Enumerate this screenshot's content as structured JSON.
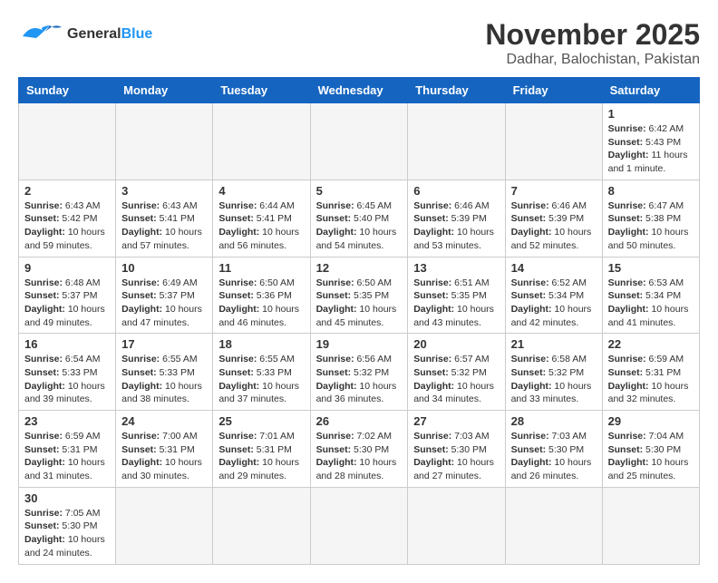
{
  "header": {
    "logo_general": "General",
    "logo_blue": "Blue",
    "month": "November 2025",
    "location": "Dadhar, Balochistan, Pakistan"
  },
  "days_of_week": [
    "Sunday",
    "Monday",
    "Tuesday",
    "Wednesday",
    "Thursday",
    "Friday",
    "Saturday"
  ],
  "weeks": [
    [
      {
        "day": "",
        "info": ""
      },
      {
        "day": "",
        "info": ""
      },
      {
        "day": "",
        "info": ""
      },
      {
        "day": "",
        "info": ""
      },
      {
        "day": "",
        "info": ""
      },
      {
        "day": "",
        "info": ""
      },
      {
        "day": "1",
        "info": "Sunrise: 6:42 AM\nSunset: 5:43 PM\nDaylight: 11 hours and 1 minute."
      }
    ],
    [
      {
        "day": "2",
        "info": "Sunrise: 6:43 AM\nSunset: 5:42 PM\nDaylight: 10 hours and 59 minutes."
      },
      {
        "day": "3",
        "info": "Sunrise: 6:43 AM\nSunset: 5:41 PM\nDaylight: 10 hours and 57 minutes."
      },
      {
        "day": "4",
        "info": "Sunrise: 6:44 AM\nSunset: 5:41 PM\nDaylight: 10 hours and 56 minutes."
      },
      {
        "day": "5",
        "info": "Sunrise: 6:45 AM\nSunset: 5:40 PM\nDaylight: 10 hours and 54 minutes."
      },
      {
        "day": "6",
        "info": "Sunrise: 6:46 AM\nSunset: 5:39 PM\nDaylight: 10 hours and 53 minutes."
      },
      {
        "day": "7",
        "info": "Sunrise: 6:46 AM\nSunset: 5:39 PM\nDaylight: 10 hours and 52 minutes."
      },
      {
        "day": "8",
        "info": "Sunrise: 6:47 AM\nSunset: 5:38 PM\nDaylight: 10 hours and 50 minutes."
      }
    ],
    [
      {
        "day": "9",
        "info": "Sunrise: 6:48 AM\nSunset: 5:37 PM\nDaylight: 10 hours and 49 minutes."
      },
      {
        "day": "10",
        "info": "Sunrise: 6:49 AM\nSunset: 5:37 PM\nDaylight: 10 hours and 47 minutes."
      },
      {
        "day": "11",
        "info": "Sunrise: 6:50 AM\nSunset: 5:36 PM\nDaylight: 10 hours and 46 minutes."
      },
      {
        "day": "12",
        "info": "Sunrise: 6:50 AM\nSunset: 5:35 PM\nDaylight: 10 hours and 45 minutes."
      },
      {
        "day": "13",
        "info": "Sunrise: 6:51 AM\nSunset: 5:35 PM\nDaylight: 10 hours and 43 minutes."
      },
      {
        "day": "14",
        "info": "Sunrise: 6:52 AM\nSunset: 5:34 PM\nDaylight: 10 hours and 42 minutes."
      },
      {
        "day": "15",
        "info": "Sunrise: 6:53 AM\nSunset: 5:34 PM\nDaylight: 10 hours and 41 minutes."
      }
    ],
    [
      {
        "day": "16",
        "info": "Sunrise: 6:54 AM\nSunset: 5:33 PM\nDaylight: 10 hours and 39 minutes."
      },
      {
        "day": "17",
        "info": "Sunrise: 6:55 AM\nSunset: 5:33 PM\nDaylight: 10 hours and 38 minutes."
      },
      {
        "day": "18",
        "info": "Sunrise: 6:55 AM\nSunset: 5:33 PM\nDaylight: 10 hours and 37 minutes."
      },
      {
        "day": "19",
        "info": "Sunrise: 6:56 AM\nSunset: 5:32 PM\nDaylight: 10 hours and 36 minutes."
      },
      {
        "day": "20",
        "info": "Sunrise: 6:57 AM\nSunset: 5:32 PM\nDaylight: 10 hours and 34 minutes."
      },
      {
        "day": "21",
        "info": "Sunrise: 6:58 AM\nSunset: 5:32 PM\nDaylight: 10 hours and 33 minutes."
      },
      {
        "day": "22",
        "info": "Sunrise: 6:59 AM\nSunset: 5:31 PM\nDaylight: 10 hours and 32 minutes."
      }
    ],
    [
      {
        "day": "23",
        "info": "Sunrise: 6:59 AM\nSunset: 5:31 PM\nDaylight: 10 hours and 31 minutes."
      },
      {
        "day": "24",
        "info": "Sunrise: 7:00 AM\nSunset: 5:31 PM\nDaylight: 10 hours and 30 minutes."
      },
      {
        "day": "25",
        "info": "Sunrise: 7:01 AM\nSunset: 5:31 PM\nDaylight: 10 hours and 29 minutes."
      },
      {
        "day": "26",
        "info": "Sunrise: 7:02 AM\nSunset: 5:30 PM\nDaylight: 10 hours and 28 minutes."
      },
      {
        "day": "27",
        "info": "Sunrise: 7:03 AM\nSunset: 5:30 PM\nDaylight: 10 hours and 27 minutes."
      },
      {
        "day": "28",
        "info": "Sunrise: 7:03 AM\nSunset: 5:30 PM\nDaylight: 10 hours and 26 minutes."
      },
      {
        "day": "29",
        "info": "Sunrise: 7:04 AM\nSunset: 5:30 PM\nDaylight: 10 hours and 25 minutes."
      }
    ],
    [
      {
        "day": "30",
        "info": "Sunrise: 7:05 AM\nSunset: 5:30 PM\nDaylight: 10 hours and 24 minutes."
      },
      {
        "day": "",
        "info": ""
      },
      {
        "day": "",
        "info": ""
      },
      {
        "day": "",
        "info": ""
      },
      {
        "day": "",
        "info": ""
      },
      {
        "day": "",
        "info": ""
      },
      {
        "day": "",
        "info": ""
      }
    ]
  ]
}
